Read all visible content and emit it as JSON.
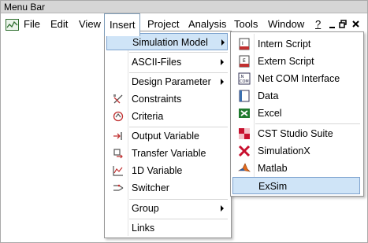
{
  "window": {
    "title": "Menu Bar"
  },
  "menubar": {
    "items": [
      "File",
      "Edit",
      "View",
      "Insert",
      "Project",
      "Analysis",
      "Tools",
      "Window",
      "?"
    ],
    "open_item": "Insert"
  },
  "insert_menu": {
    "items": [
      {
        "label": "Simulation Model",
        "submenu": true,
        "icon": ""
      },
      {
        "label": "ASCII-Files",
        "submenu": true,
        "icon": ""
      },
      {
        "label": "Design Parameter",
        "submenu": true,
        "icon": ""
      },
      {
        "label": "Constraints",
        "submenu": false,
        "icon": "constraints-icon"
      },
      {
        "label": "Criteria",
        "submenu": false,
        "icon": "criteria-icon"
      },
      {
        "label": "Output Variable",
        "submenu": false,
        "icon": "output-variable-icon"
      },
      {
        "label": "Transfer Variable",
        "submenu": false,
        "icon": "transfer-variable-icon"
      },
      {
        "label": "1D Variable",
        "submenu": false,
        "icon": "1d-variable-icon"
      },
      {
        "label": "Switcher",
        "submenu": false,
        "icon": "switcher-icon"
      },
      {
        "label": "Group",
        "submenu": true,
        "icon": ""
      },
      {
        "label": "Links",
        "submenu": false,
        "icon": ""
      }
    ]
  },
  "simulation_submenu": {
    "items": [
      {
        "label": "Intern Script",
        "icon": "intern-script-icon"
      },
      {
        "label": "Extern Script",
        "icon": "extern-script-icon"
      },
      {
        "label": "Net COM Interface",
        "icon": "net-com-icon"
      },
      {
        "label": "Data",
        "icon": "data-icon"
      },
      {
        "label": "Excel",
        "icon": "excel-icon"
      },
      {
        "label": "CST Studio Suite",
        "icon": "cst-icon"
      },
      {
        "label": "SimulationX",
        "icon": "simulationx-icon"
      },
      {
        "label": "Matlab",
        "icon": "matlab-icon"
      },
      {
        "label": "ExSim",
        "icon": ""
      }
    ],
    "highlighted": "ExSim"
  },
  "colors": {
    "highlight_bg": "#cfe4f7",
    "highlight_border": "#7da2ce"
  }
}
